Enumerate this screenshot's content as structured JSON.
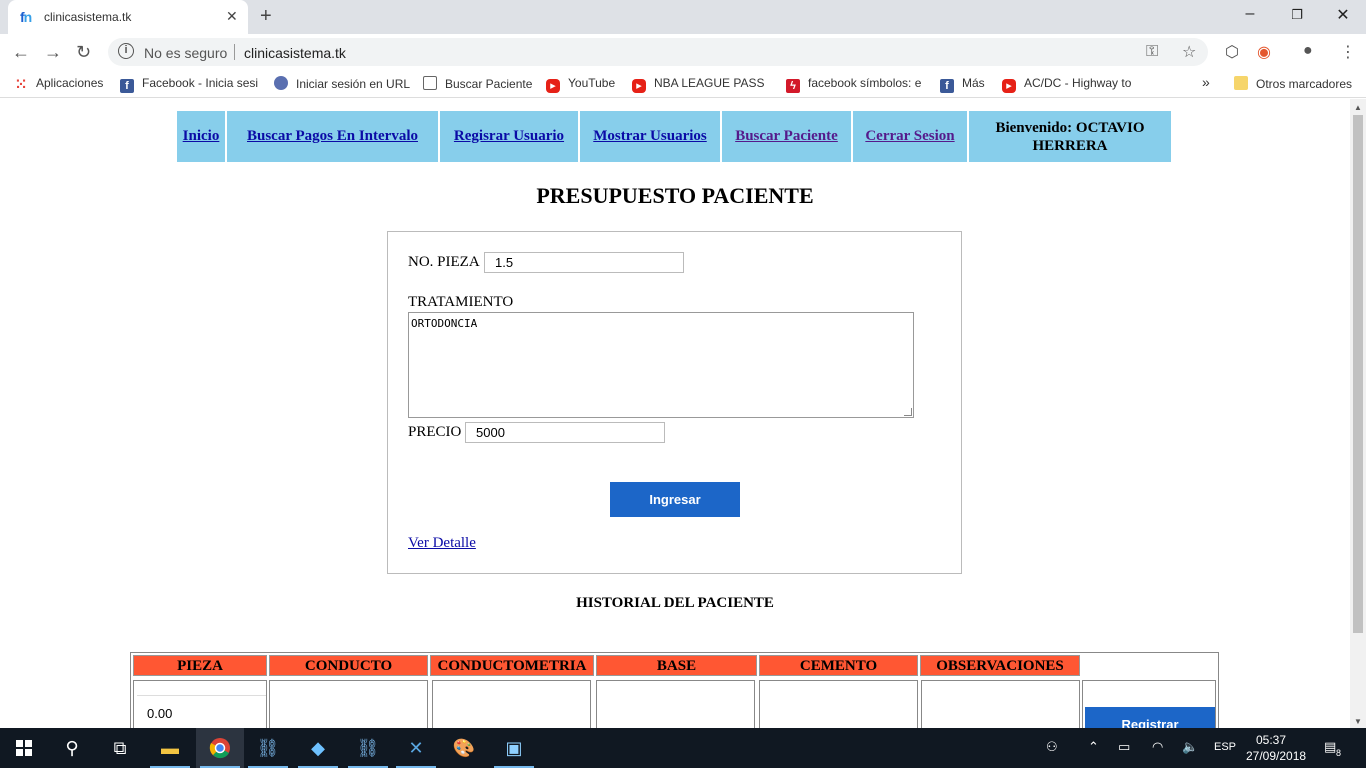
{
  "browser": {
    "tab_title": "clinicasistema.tk",
    "security_label": "No es seguro",
    "url": "clinicasistema.tk",
    "new_tab_symbol": "+",
    "bookmarks": [
      {
        "label": "Aplicaciones",
        "icon": "apps-icon"
      },
      {
        "label": "Facebook - Inicia sesi",
        "icon": "facebook-icon"
      },
      {
        "label": "Iniciar sesión en URL",
        "icon": "globe-icon"
      },
      {
        "label": "Buscar Paciente",
        "icon": "document-icon"
      },
      {
        "label": "YouTube",
        "icon": "youtube-icon"
      },
      {
        "label": "NBA LEAGUE PASS H",
        "icon": "youtube-icon"
      },
      {
        "label": "facebook símbolos: e",
        "icon": "flash-icon"
      },
      {
        "label": "Más",
        "icon": "facebook-icon"
      },
      {
        "label": "AC/DC - Highway to",
        "icon": "youtube-icon"
      }
    ],
    "more_bookmarks": "»",
    "other_bookmarks": "Otros marcadores"
  },
  "nav": {
    "inicio": "Inicio",
    "buscar_pagos": "Buscar Pagos En Intervalo",
    "registrar_usuario": "Regisrar Usuario",
    "mostrar_usuarios": "Mostrar Usuarios",
    "buscar_paciente": "Buscar Paciente",
    "cerrar_sesion": "Cerrar Sesion",
    "welcome": "Bienvenido: OCTAVIO HERRERA"
  },
  "page_title": "PRESUPUESTO PACIENTE",
  "form": {
    "pieza_label": "NO. PIEZA",
    "pieza_value": "1.5",
    "tratamiento_label": "TRATAMIENTO",
    "tratamiento_value": "ORTODONCIA",
    "precio_label": "PRECIO",
    "precio_value": "5000",
    "submit_label": "Ingresar",
    "detail_link": "Ver Detalle"
  },
  "history": {
    "title": "HISTORIAL DEL PACIENTE",
    "columns": [
      "PIEZA",
      "CONDUCTO",
      "CONDUCTOMETRIA",
      "BASE",
      "CEMENTO",
      "OBSERVACIONES"
    ],
    "pieza_value": "0.00",
    "register_label": "Registrar"
  },
  "taskbar": {
    "language": "ESP",
    "time": "05:37",
    "date": "27/09/2018",
    "notification_count": "8"
  }
}
